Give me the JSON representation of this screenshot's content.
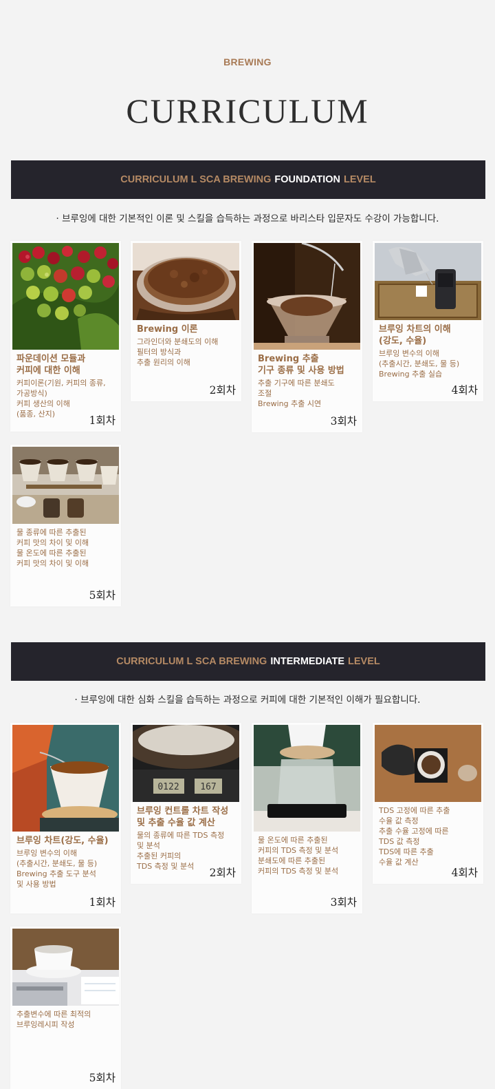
{
  "header": {
    "eyebrow": "BREWING",
    "title": "CURRICULUM"
  },
  "sections": [
    {
      "band": {
        "prefix": "CURRICULUM L SCA BREWING",
        "highlight": "FOUNDATION",
        "suffix": "LEVEL"
      },
      "description": "· 브루잉에 대한 기본적인 이론 및 스킬을 습득하는 과정으로 바리스타 입문자도 수강이 가능합니다.",
      "cards": [
        {
          "image": "coffee-cherries-image",
          "heading": "파운데이션 모듈과\n커피에 대한 이해",
          "body": "커피이론(기원, 커피의 종류,\n가공방식)\n커피 생산의 이해\n(품종, 산지)",
          "session": "1회차"
        },
        {
          "image": "ground-coffee-portafilter-image",
          "heading": "Brewing 이론",
          "body": "그라인더와 분쇄도의 이해\n필터의 방식과\n추출 원리의 이해",
          "session": "2회차"
        },
        {
          "image": "pour-over-dripper-image",
          "heading": "Brewing 추출\n기구 종류 및 사용 방법",
          "body": "추출 기구에 따른 분쇄도\n조절\nBrewing 추출 시연",
          "session": "3회차"
        },
        {
          "image": "kettle-pouring-image",
          "heading": "브루잉 차트의 이해\n(강도, 수율)",
          "body": "브루잉 변수의 이해\n(추출시간, 분쇄도, 물 등)\nBrewing 추출 실습",
          "session": "4회차"
        },
        {
          "image": "multiple-drippers-image",
          "heading": "",
          "body": "물 종류에 따른 추출된\n커피 맛의 차이 및 이해\n물 온도에 따른 추출된\n커피 맛의 차이 및 이해",
          "session": "5회차"
        }
      ]
    },
    {
      "band": {
        "prefix": "CURRICULUM L SCA BREWING",
        "highlight": "INTERMEDIATE",
        "suffix": "LEVEL"
      },
      "description": "· 브루잉에 대한 심화 스킬을 습득하는 과정으로 커피에 대한 기본적인 이해가 필요합니다.",
      "cards": [
        {
          "image": "copper-kettle-dripper-image",
          "heading": "브루잉 차트(강도, 수율)",
          "body": "브루잉 변수의 이해\n(추출시간, 분쇄도, 물 등)\nBrewing 추출 도구 분석\n및 사용 방법",
          "session": "1회차"
        },
        {
          "image": "coffee-scale-image",
          "heading": "브루잉 컨트롤 차트 작성\n및 추출 수율 값 계산",
          "body": "물의 종류에 따른 TDS 측정\n및 분석\n추출된 커피의\nTDS 측정 및 분석",
          "session": "2회차"
        },
        {
          "image": "glass-server-scale-image",
          "heading": "",
          "body": "물 온도에 따른 추출된\n커피의 TDS 측정 및 분석\n분쇄도에 따른 추출된\n커피의 TDS 측정 및 분석",
          "session": "3회차"
        },
        {
          "image": "brewing-setup-topview-image",
          "heading": "",
          "body": "TDS 고정에 따른 추출\n수율 값 측정\n추출 수율 고정에 따른\nTDS 값 측정\nTDS에 따른 추출\n수율 값 계산",
          "session": "4회차"
        },
        {
          "image": "coffee-cup-calculator-image",
          "heading": "",
          "body": "추출변수에 따른 최적의\n브루잉레시피 작성",
          "session": "5회차"
        }
      ]
    }
  ],
  "colors": {
    "accent": "#b58a64",
    "band": "#25242c",
    "text_brown": "#9a6d46",
    "background": "#f3f3f3"
  }
}
